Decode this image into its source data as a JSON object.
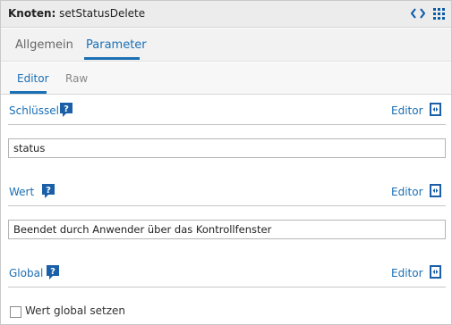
{
  "header": {
    "title_prefix": "Knoten:",
    "title_value": "setStatusDelete",
    "code_icon": "code-brackets-icon",
    "grid_icon": "grid-menu-icon"
  },
  "tabs": [
    {
      "label": "Allgemein",
      "active": false
    },
    {
      "label": "Parameter",
      "active": true
    }
  ],
  "subtabs": [
    {
      "label": "Editor",
      "active": true
    },
    {
      "label": "Raw",
      "active": false
    }
  ],
  "sections": {
    "key": {
      "label": "Schlüssel",
      "editor_label": "Editor",
      "value": "status"
    },
    "value": {
      "label": "Wert",
      "editor_label": "Editor",
      "value": "Beendet durch Anwender über das Kontrollfenster"
    },
    "global": {
      "label": "Global",
      "editor_label": "Editor"
    }
  },
  "checkbox": {
    "label": "Wert global setzen",
    "checked": false
  },
  "colors": {
    "accent": "#1a6fb5",
    "header_bg": "#ececec",
    "tab_bg": "#f2f2f2",
    "help_icon": "#1a5fa8"
  }
}
